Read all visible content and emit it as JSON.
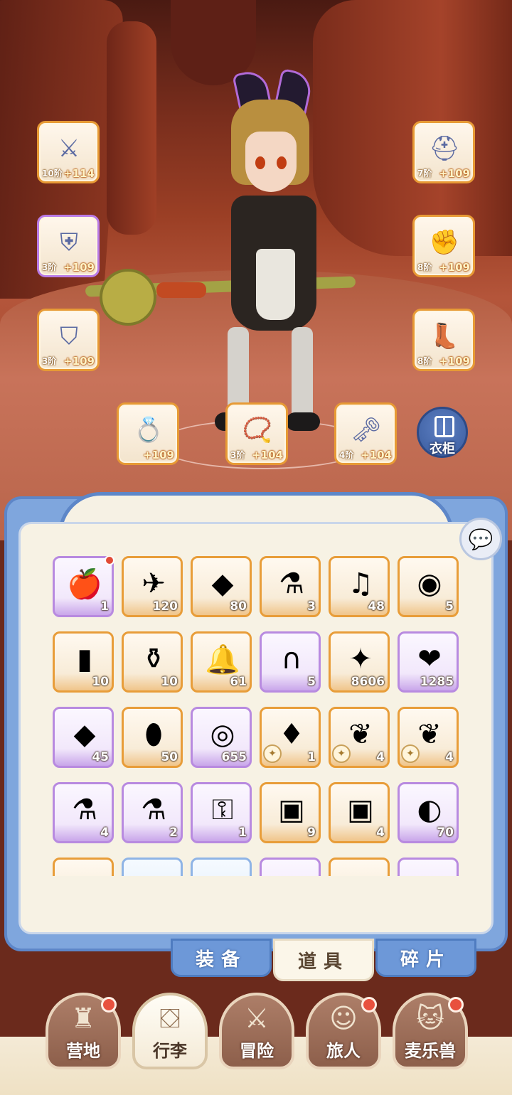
{
  "equipment": {
    "weapon": {
      "icon": "axe-icon",
      "glyph": "⚔",
      "tier": "10阶",
      "plus": "+114"
    },
    "armor": {
      "icon": "chestplate-icon",
      "glyph": "⛨",
      "tier": "3阶",
      "plus": "+109"
    },
    "pants": {
      "icon": "leg-armor-icon",
      "glyph": "⛉",
      "tier": "3阶",
      "plus": "+109"
    },
    "helmet": {
      "icon": "helmet-icon",
      "glyph": "⛑",
      "tier": "7阶",
      "plus": "+109"
    },
    "gloves": {
      "icon": "gauntlet-icon",
      "glyph": "✊",
      "tier": "8阶",
      "plus": "+109"
    },
    "boots": {
      "icon": "boots-icon",
      "glyph": "👢",
      "tier": "8阶",
      "plus": "+109"
    },
    "ring": {
      "icon": "ring-icon",
      "glyph": "💍",
      "tier": "",
      "plus": "+109"
    },
    "necklace": {
      "icon": "necklace-icon",
      "glyph": "📿",
      "tier": "3阶",
      "plus": "+104"
    },
    "charm": {
      "icon": "charm-icon",
      "glyph": "🗝",
      "tier": "4阶",
      "plus": "+104"
    }
  },
  "wardrobe": {
    "label": "衣柜",
    "icon": "wardrobe-icon"
  },
  "inventory": {
    "items": [
      {
        "icon": "apple-icon",
        "glyph": "🍎",
        "count": "1",
        "rarity": "purple",
        "new": true
      },
      {
        "icon": "paper-plane-icon",
        "glyph": "✈",
        "count": "120",
        "rarity": "orange"
      },
      {
        "icon": "gold-crystal-icon",
        "glyph": "◆",
        "count": "80",
        "rarity": "orange"
      },
      {
        "icon": "blue-potion-icon",
        "glyph": "⚗",
        "count": "3",
        "rarity": "orange"
      },
      {
        "icon": "lyre-icon",
        "glyph": "♫",
        "count": "48",
        "rarity": "orange"
      },
      {
        "icon": "crystal-orb-icon",
        "glyph": "◉",
        "count": "5",
        "rarity": "orange"
      },
      {
        "icon": "rainbow-tube-icon",
        "glyph": "▮",
        "count": "10",
        "rarity": "orange"
      },
      {
        "icon": "rainbow-bottle-icon",
        "glyph": "⚱",
        "count": "10",
        "rarity": "orange"
      },
      {
        "icon": "bell-icon",
        "glyph": "🔔",
        "count": "61",
        "rarity": "orange"
      },
      {
        "icon": "horseshoe-icon",
        "glyph": "∩",
        "count": "5",
        "rarity": "purple"
      },
      {
        "icon": "star-crystal-icon",
        "glyph": "✦",
        "count": "8606",
        "rarity": "orange"
      },
      {
        "icon": "heart-icon",
        "glyph": "❤",
        "count": "1285",
        "rarity": "purple"
      },
      {
        "icon": "purple-gem-icon",
        "glyph": "◆",
        "count": "45",
        "rarity": "purple"
      },
      {
        "icon": "golden-egg-icon",
        "glyph": "⬮",
        "count": "50",
        "rarity": "orange"
      },
      {
        "icon": "heart-coin-icon",
        "glyph": "◎",
        "count": "655",
        "rarity": "purple"
      },
      {
        "icon": "fire-crystal-icon",
        "glyph": "♦",
        "count": "1",
        "rarity": "orange",
        "badge": "sword-badge-icon"
      },
      {
        "icon": "sprout-crystal-icon",
        "glyph": "❦",
        "count": "4",
        "rarity": "orange",
        "badge": "helmet-badge-icon"
      },
      {
        "icon": "sprout-crystal-icon",
        "glyph": "❦",
        "count": "4",
        "rarity": "orange",
        "badge": "key-badge-icon"
      },
      {
        "icon": "blue-flask-icon",
        "glyph": "⚗",
        "count": "4",
        "rarity": "purple"
      },
      {
        "icon": "red-flask-icon",
        "glyph": "⚗",
        "count": "2",
        "rarity": "purple"
      },
      {
        "icon": "golden-key-icon",
        "glyph": "⚿",
        "count": "1",
        "rarity": "purple"
      },
      {
        "icon": "blue-card-icon",
        "glyph": "▣",
        "count": "9",
        "rarity": "orange"
      },
      {
        "icon": "gold-card-icon",
        "glyph": "▣",
        "count": "4",
        "rarity": "orange"
      },
      {
        "icon": "cat-portal-icon",
        "glyph": "◐",
        "count": "70",
        "rarity": "purple"
      },
      {
        "icon": "partial-item-icon",
        "glyph": "",
        "count": "",
        "rarity": "orange"
      },
      {
        "icon": "partial-item-icon",
        "glyph": "",
        "count": "",
        "rarity": "blue"
      },
      {
        "icon": "partial-item-icon",
        "glyph": "",
        "count": "",
        "rarity": "blue"
      },
      {
        "icon": "partial-item-icon",
        "glyph": "",
        "count": "",
        "rarity": "purple"
      },
      {
        "icon": "partial-item-icon",
        "glyph": "",
        "count": "",
        "rarity": "orange"
      },
      {
        "icon": "partial-item-icon",
        "glyph": "",
        "count": "",
        "rarity": "purple"
      }
    ]
  },
  "tabs": {
    "equipment": "装备",
    "items": "道具",
    "fragments": "碎片",
    "active": "items"
  },
  "nav": {
    "camp": {
      "label": "营地",
      "glyph": "♜",
      "icon": "castle-icon",
      "dot": true
    },
    "bag": {
      "label": "行李",
      "glyph": "⛋",
      "icon": "backpack-icon",
      "dot": false
    },
    "adventure": {
      "label": "冒险",
      "glyph": "⚔",
      "icon": "crossed-swords-icon",
      "dot": false
    },
    "travelers": {
      "label": "旅人",
      "glyph": "☺",
      "icon": "traveler-icon",
      "dot": true
    },
    "pets": {
      "label": "麦乐兽",
      "glyph": "🐱",
      "icon": "pet-icon",
      "dot": true
    }
  }
}
